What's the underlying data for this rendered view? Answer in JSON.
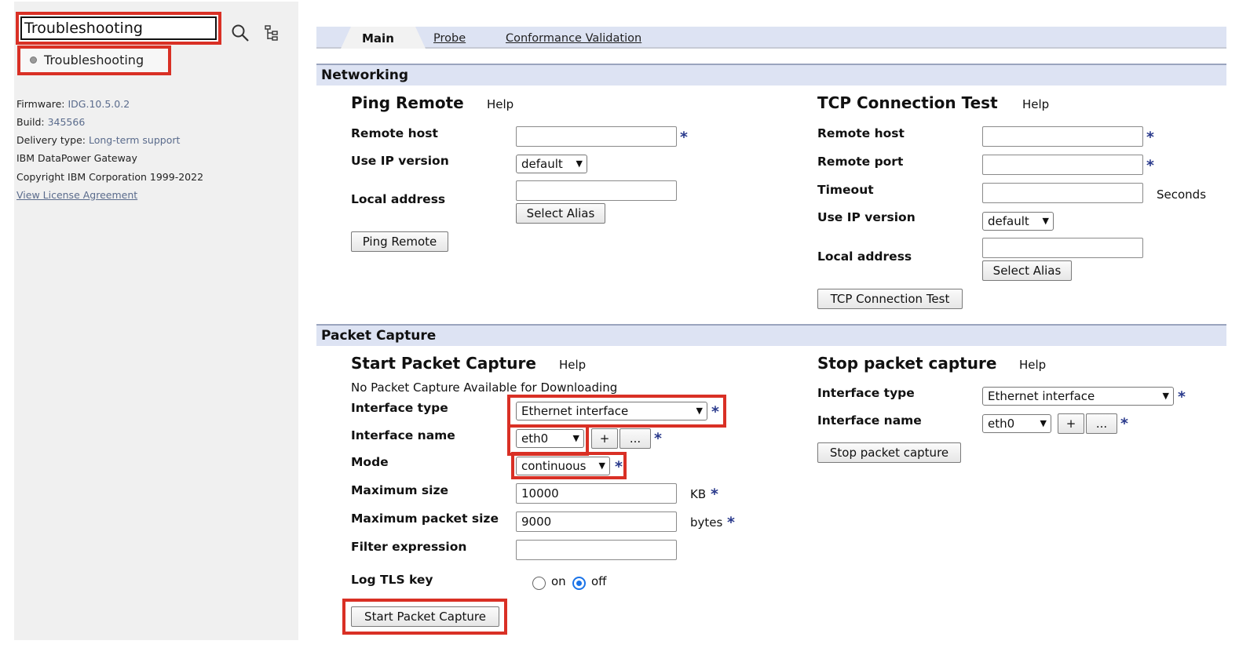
{
  "sidebar": {
    "search_value": "Troubleshooting",
    "search_icon": "search-icon",
    "tree_icon": "tree-view-icon",
    "result_label": "Troubleshooting",
    "firmware_label": "Firmware:",
    "firmware_value": "IDG.10.5.0.2",
    "build_label": "Build:",
    "build_value": "345566",
    "delivery_label": "Delivery type:",
    "delivery_value": "Long-term support",
    "product": "IBM DataPower Gateway",
    "copyright": "Copyright IBM Corporation 1999-2022",
    "license_link": "View License Agreement"
  },
  "tabs": {
    "main": "Main",
    "probe": "Probe",
    "conformance": "Conformance Validation"
  },
  "networking": {
    "header": "Networking",
    "ping": {
      "title": "Ping Remote",
      "help": "Help",
      "remote_host_label": "Remote host",
      "ip_version_label": "Use IP version",
      "ip_version_value": "default",
      "local_address_label": "Local address",
      "select_alias": "Select Alias",
      "button": "Ping Remote"
    },
    "tcp": {
      "title": "TCP Connection Test",
      "help": "Help",
      "remote_host_label": "Remote host",
      "remote_port_label": "Remote port",
      "timeout_label": "Timeout",
      "timeout_unit": "Seconds",
      "ip_version_label": "Use IP version",
      "ip_version_value": "default",
      "local_address_label": "Local address",
      "select_alias": "Select Alias",
      "button": "TCP Connection Test"
    }
  },
  "packet_capture": {
    "header": "Packet Capture",
    "start": {
      "title": "Start Packet Capture",
      "help": "Help",
      "status": "No Packet Capture Available for Downloading",
      "interface_type_label": "Interface type",
      "interface_type_value": "Ethernet interface",
      "interface_name_label": "Interface name",
      "interface_name_value": "eth0",
      "add_label": "+",
      "browse_label": "...",
      "mode_label": "Mode",
      "mode_value": "continuous",
      "max_size_label": "Maximum size",
      "max_size_value": "10000",
      "max_size_unit": "KB",
      "max_packet_label": "Maximum packet size",
      "max_packet_value": "9000",
      "max_packet_unit": "bytes",
      "filter_label": "Filter expression",
      "filter_value": "",
      "log_tls_label": "Log TLS key",
      "on_label": "on",
      "off_label": "off",
      "log_tls_selected": "off",
      "button": "Start Packet Capture"
    },
    "stop": {
      "title": "Stop packet capture",
      "help": "Help",
      "interface_type_label": "Interface type",
      "interface_type_value": "Ethernet interface",
      "interface_name_label": "Interface name",
      "interface_name_value": "eth0",
      "add_label": "+",
      "browse_label": "...",
      "button": "Stop packet capture"
    }
  },
  "required_marker": "*",
  "colors": {
    "highlight": "#d93025",
    "section_bg": "#dde3f3",
    "required": "#2a3a8c",
    "info_link": "#5a6b8c"
  }
}
